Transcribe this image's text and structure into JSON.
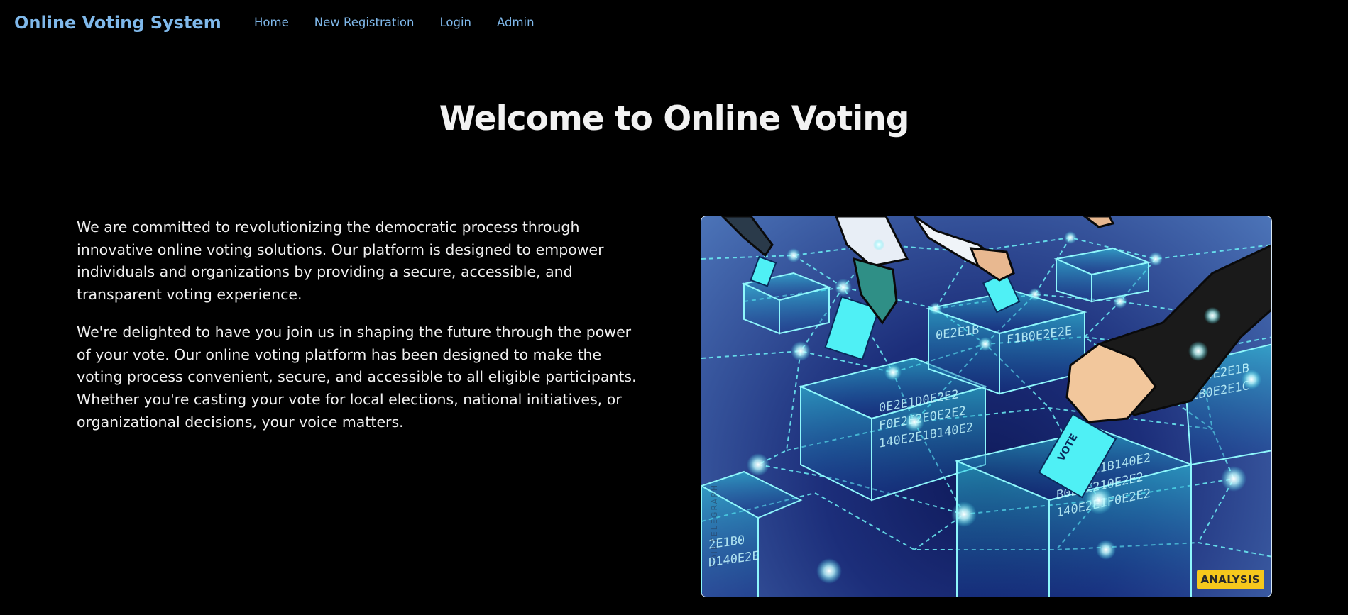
{
  "brand": "Online Voting System",
  "nav": {
    "home": "Home",
    "register": "New Registration",
    "login": "Login",
    "admin": "Admin"
  },
  "hero": {
    "title": "Welcome to Online Voting"
  },
  "content": {
    "paragraph1": "We are committed to revolutionizing the democratic process through innovative online voting solutions. Our platform is designed to empower individuals and organizations by providing a secure, accessible, and transparent voting experience.",
    "paragraph2": "We're delighted to have you join us in shaping the future through the power of your vote. Our online voting platform has been designed to make the voting process convenient, secure, and accessible to all eligible participants. Whether you're casting your vote for local elections, national initiatives, or organizational decisions, your voice matters."
  },
  "image": {
    "badge": "ANALYSIS",
    "watermark": "COINTELEGRAPH",
    "ballot_text": "VOTE",
    "box_text": "0E2E1D0E2E2 F0E2E2E0E2E2 140E2E1B140E2E1 B0E2E210E2E2"
  },
  "colors": {
    "background": "#000000",
    "nav_text": "#7fb8ea",
    "title_text": "#f2f2f2",
    "body_text": "#f0f0f0",
    "badge_bg": "#f6c81c",
    "neon": "#46e8f0"
  }
}
